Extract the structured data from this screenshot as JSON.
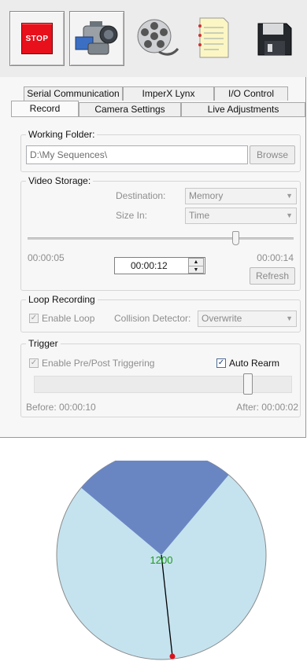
{
  "toolbar": {
    "stop_label": "STOP",
    "icons": [
      "stop-icon",
      "camera-icon",
      "film-reel-icon",
      "notepad-icon",
      "floppy-disk-icon"
    ]
  },
  "tabs": {
    "row_back": [
      "Serial Communication",
      "ImperX Lynx",
      "I/O Control"
    ],
    "row_front": [
      "Record",
      "Camera Settings",
      "Live Adjustments"
    ],
    "selected": "Record"
  },
  "working_folder": {
    "label": "Working Folder:",
    "path": "D:\\My Sequences\\",
    "browse": "Browse"
  },
  "video_storage": {
    "label": "Video Storage:",
    "destination_label": "Destination:",
    "destination_value": "Memory",
    "size_in_label": "Size In:",
    "size_in_value": "Time",
    "slider_position": 0.78,
    "min_time": "00:00:05",
    "max_time": "00:00:14",
    "current_time": "00:00:12",
    "refresh": "Refresh"
  },
  "loop_recording": {
    "label": "Loop Recording",
    "enable_loop": "Enable Loop",
    "enable_loop_checked": true,
    "collision_label": "Collision Detector:",
    "collision_value": "Overwrite"
  },
  "trigger": {
    "label": "Trigger",
    "prepost": "Enable Pre/Post Triggering",
    "prepost_checked": true,
    "auto_rearm": "Auto Rearm",
    "auto_rearm_checked": true,
    "slider_position": 0.83,
    "before": "Before: 00:00:10",
    "after": "After: 00:00:02"
  },
  "gauge": {
    "value_label": "1200",
    "colors": {
      "disk": "#c5e3ef",
      "wedge": "#6a86c2",
      "hand": "#000000",
      "dot": "#e0101a",
      "value_text": "#1e9a1e"
    }
  }
}
